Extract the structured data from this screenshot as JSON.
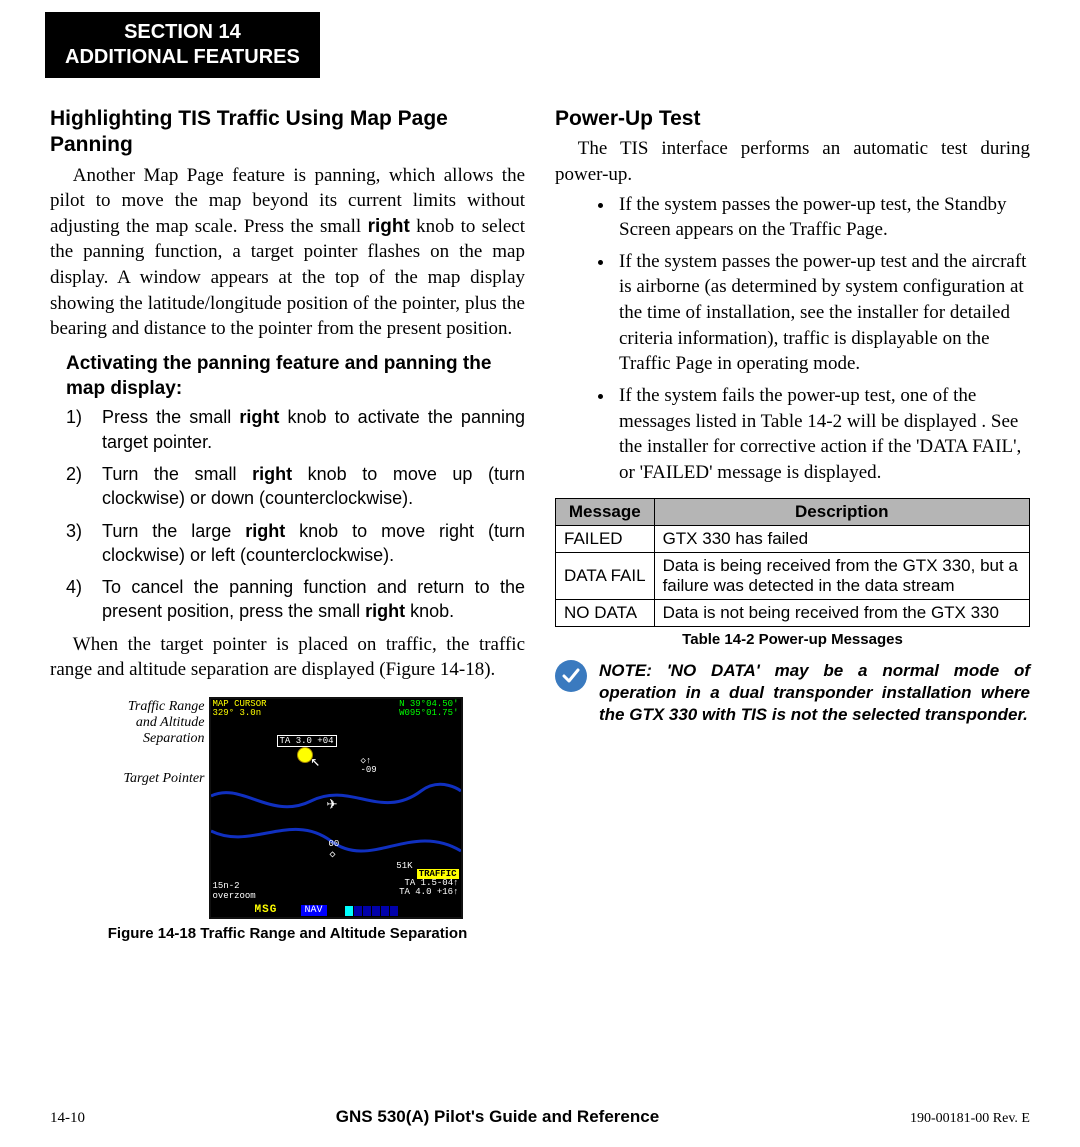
{
  "header": {
    "section_line1": "SECTION 14",
    "section_line2": "ADDITIONAL FEATURES"
  },
  "left": {
    "heading": "Highlighting TIS Traffic Using Map Page Panning",
    "para1_pre": "Another Map Page feature is panning, which allows the pilot to move the map beyond its current limits without adjusting the map scale.  Press the small ",
    "para1_bold1": "right",
    "para1_mid": " knob to select the panning function, a target pointer flashes on the map display.  A window appears at the top of the map display showing the latitude/longitude position of the pointer, plus the bearing and distance to the pointer from the present position.",
    "sub1": "Activating the panning feature and panning the map display:",
    "steps": [
      {
        "num": "1)",
        "pre": "Press the small ",
        "b": "right",
        "post": " knob to activate the panning target pointer."
      },
      {
        "num": "2)",
        "pre": "Turn the small ",
        "b": "right",
        "post": " knob to move up (turn clockwise) or down (counterclockwise)."
      },
      {
        "num": "3)",
        "pre": "Turn the large ",
        "b": "right",
        "post": " knob to move right (turn clockwise) or left (counterclockwise)."
      },
      {
        "num": "4)",
        "pre": "To cancel the panning function and return to the present position, press the small ",
        "b": "right",
        "post": " knob."
      }
    ],
    "para2": "When the target pointer is placed on traffic, the traffic range and altitude separation are displayed (Figure 14-18).",
    "fig": {
      "label_traffic": "Traffic Range and Altitude Separation",
      "label_target": "Target Pointer",
      "caption": "Figure 14-18  Traffic Range and Altitude Separation",
      "map": {
        "top_left_l1": "MAP CURSOR",
        "top_left_l2": "329°  3.0n",
        "top_right_l1": "N 39°04.50'",
        "top_right_l2": "W095°01.75'",
        "ta_tag": "TA 3.0 +04",
        "neg09_up": "◇↑",
        "neg09": "-09",
        "zero": "00",
        "k51": "51K",
        "traffic": "TRAFFIC",
        "ta_line1": "TA 1.5-04↑",
        "ta_line2": "TA 4.0 +16↑",
        "bl_l1": "15n-2",
        "bl_l2": "overzoom",
        "msg": "MSG",
        "nav": "NAV"
      }
    }
  },
  "right": {
    "heading": "Power-Up Test",
    "para1": "The TIS interface performs an automatic test during power-up.",
    "bullets": [
      "If the system passes the power-up test, the Standby Screen appears on the Traffic Page.",
      "If the system passes the power-up test and the aircraft is airborne (as determined by system configuration at the time of installation, see the installer for detailed criteria information), traffic is displayable on the Traffic Page in operating mode.",
      "If the system fails the power-up test, one of the messages listed in Table 14-2 will be displayed . See the installer for corrective action if the 'DATA FAIL', or 'FAILED' message is displayed."
    ],
    "table": {
      "head_msg": "Message",
      "head_desc": "Description",
      "rows": [
        {
          "msg": "FAILED",
          "desc": "GTX 330 has failed"
        },
        {
          "msg": "DATA FAIL",
          "desc": "Data is being received from the GTX 330, but a failure was detected in the data stream"
        },
        {
          "msg": "NO DATA",
          "desc": "Data is not being received from the GTX 330"
        }
      ],
      "caption": "Table 14-2  Power-up Messages"
    },
    "note_icon": "✓",
    "note": "NOTE:  'NO DATA' may be a normal mode of operation in a dual transponder installation where the GTX 330 with TIS is not the selected transponder."
  },
  "footer": {
    "page": "14-10",
    "center": "GNS 530(A) Pilot's Guide and Reference",
    "rev": "190-00181-00  Rev. E"
  }
}
